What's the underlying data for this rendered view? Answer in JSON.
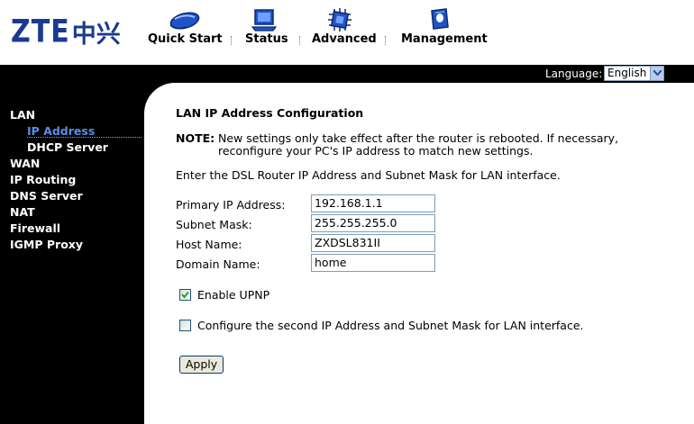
{
  "header": {
    "logo_latin": "ZTE",
    "logo_cjk": "中兴",
    "nav": [
      {
        "label": "Quick Start",
        "icon": "mouse-icon"
      },
      {
        "label": "Status",
        "icon": "monitor-icon"
      },
      {
        "label": "Advanced",
        "icon": "chip-icon"
      },
      {
        "label": "Management",
        "icon": "document-icon"
      }
    ],
    "language_label": "Language:",
    "language_value": "English"
  },
  "sidebar": {
    "items": [
      {
        "label": "LAN"
      },
      {
        "label": "IP Address",
        "selected": true
      },
      {
        "label": "DHCP Server"
      },
      {
        "label": "WAN"
      },
      {
        "label": "IP Routing"
      },
      {
        "label": "DNS Server"
      },
      {
        "label": "NAT"
      },
      {
        "label": "Firewall"
      },
      {
        "label": "IGMP Proxy"
      }
    ]
  },
  "main": {
    "title": "LAN IP Address Configuration",
    "note_label": "NOTE:",
    "note_line1": "New settings only take effect after the router is rebooted. If necessary,",
    "note_line2": "reconfigure your PC's IP address to match new settings.",
    "instruction": "Enter the DSL Router IP Address and Subnet Mask for LAN interface.",
    "fields": [
      {
        "label": "Primary IP Address:",
        "value": "192.168.1.1"
      },
      {
        "label": "Subnet Mask:",
        "value": "255.255.255.0"
      },
      {
        "label": "Host Name:",
        "value": "ZXDSL831II"
      },
      {
        "label": "Domain Name:",
        "value": "home"
      }
    ],
    "enable_upnp": {
      "label": "Enable UPNP",
      "checked": true
    },
    "second_ip": {
      "label": "Configure the second IP Address and Subnet Mask for LAN interface.",
      "checked": false
    },
    "apply_label": "Apply"
  },
  "colors": {
    "brand_blue": "#1a3a8f",
    "selected_nav": "#5b8ee6",
    "background": "#000000"
  }
}
